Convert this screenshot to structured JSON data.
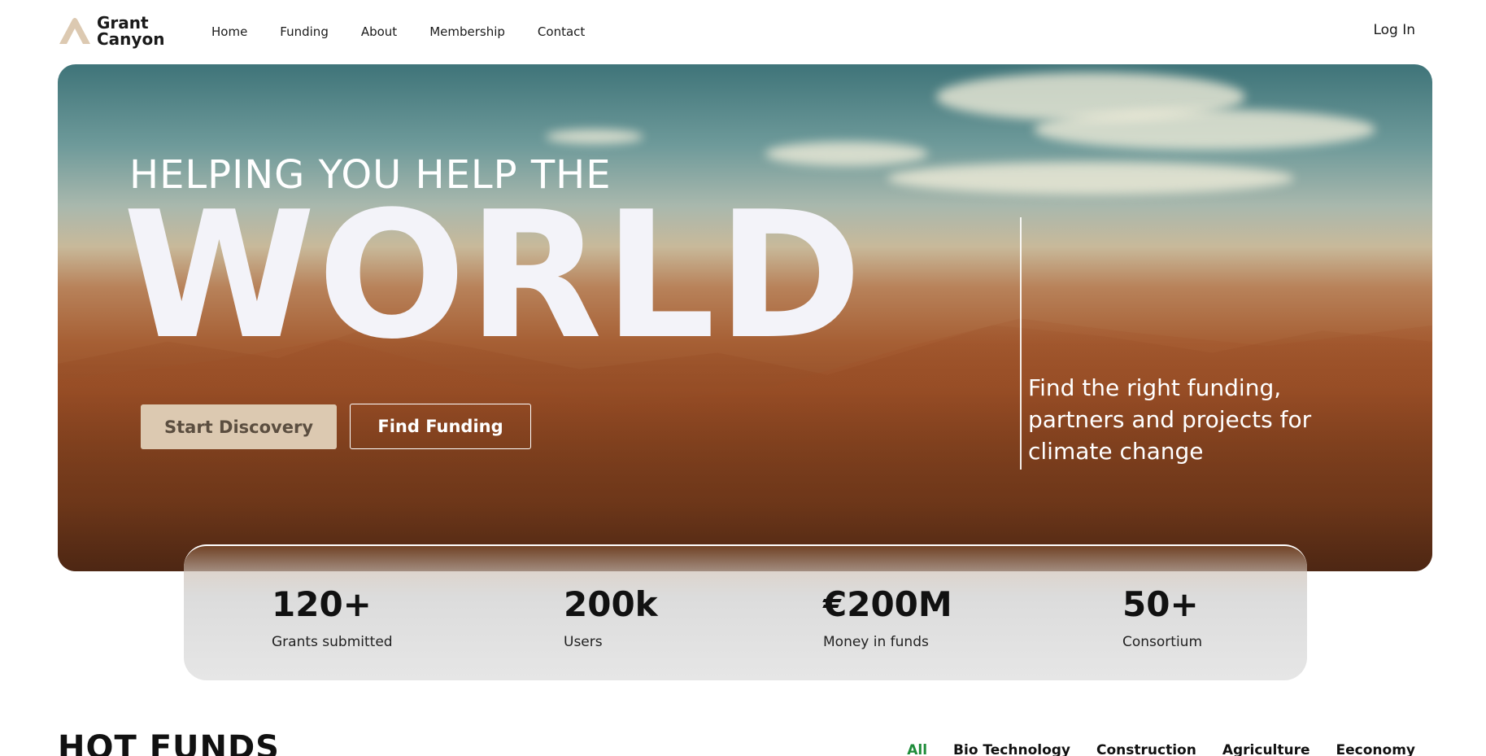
{
  "brand": {
    "line1": "Grant",
    "line2": "Canyon",
    "accent": "#dcc9b1",
    "icon": "canyon-logo-icon"
  },
  "nav": [
    {
      "label": "Home"
    },
    {
      "label": "Funding"
    },
    {
      "label": "About"
    },
    {
      "label": "Membership"
    },
    {
      "label": "Contact"
    }
  ],
  "login_label": "Log In",
  "hero": {
    "subtitle": "HELPING YOU HELP THE",
    "headline": "WORLD",
    "tagline": "Find the right funding, partners and projects for climate change",
    "primary_button": "Start Discovery",
    "secondary_button": "Find Funding"
  },
  "stats": [
    {
      "value": "120+",
      "label": "Grants submitted"
    },
    {
      "value": "200k",
      "label": "Users"
    },
    {
      "value": "€200M",
      "label": "Money in funds"
    },
    {
      "value": "50+",
      "label": "Consortium"
    }
  ],
  "hot_funds": {
    "title": "HOT FUNDS",
    "filters": [
      "All",
      "Bio Technology",
      "Construction",
      "Agriculture",
      "Eeconomy"
    ],
    "active_filter": "All",
    "active_color": "#1e8c3a"
  }
}
